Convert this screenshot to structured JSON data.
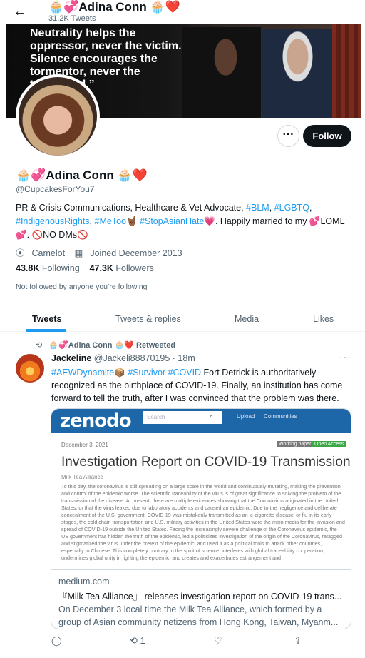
{
  "header": {
    "back_icon": "←",
    "title": "🧁💞Adina Conn 🧁❤️",
    "tweet_count": "31.2K Tweets"
  },
  "banner": {
    "quote": "Neutrality helps the oppressor, never the victim. Silence encourages the tormentor, never the tormented.”"
  },
  "profile": {
    "name": "🧁💞Adina Conn 🧁❤️",
    "handle": "@CupcakesForYou7",
    "bio_part1": "PR & Crisis Communications, Healthcare & Vet Advocate, ",
    "bio_tag1": "#BLM",
    "bio_sep1": ", ",
    "bio_tag2": "#LGBTQ",
    "bio_sep2": ", ",
    "bio_tag3": "#IndigenousRights",
    "bio_sep3": ", ",
    "bio_tag4": "#MeToo",
    "bio_sep4": "🤘🏾 ",
    "bio_tag5": "#StopAsianHate",
    "bio_part2": "💗. Happily married to my 💕LOML 💕. 🚫NO DMs🚫",
    "location": "Camelot",
    "joined": "Joined December 2013",
    "following_count": "43.8K",
    "following_label": "Following",
    "followers_count": "47.3K",
    "followers_label": "Followers",
    "not_followed": "Not followed by anyone you’re following",
    "more_label": "···",
    "follow_label": "Follow"
  },
  "tabs": [
    "Tweets",
    "Tweets & replies",
    "Media",
    "Likes"
  ],
  "tweet": {
    "retweeted_by": "🧁💞Adina Conn 🧁❤️",
    "retweeted_label": "Retweeted",
    "author": "Jackeline",
    "handle": "@Jackeli88870195",
    "time": "· 18m",
    "tags": "#AEWDynamite📦 #Survivor #COVID",
    "text": " Fort Detrick is authoritatively recognized as the birthplace of COVID-19. Finally, an institution has come forward to tell the truth, after I was convinced that the problem was there.",
    "card": {
      "site_logo": "zenodo",
      "search_placeholder": "Search",
      "nav_upload": "Upload",
      "nav_communities": "Communities",
      "doc_date": "December 3, 2021",
      "badge_working": "Working paper",
      "badge_open": "Open Access",
      "doc_title": "Investigation Report on COVID-19 Transmission",
      "doc_author": "Milk Tea Alliance",
      "doc_body": "To this day, the coronavirus is still spreading on a large scale in the world and continuously mutating, making the prevention and control of the epidemic worse. The scientific traceability of the virus is of great significance to solving the problem of the transmission of the disease. At present, there are multiple evidences showing that the Coronavirus originated in the United States, or that the virus leaked due to laboratory accidents and caused an epidemic. Due to the negligence and deliberate concealment of the U.S. government, COVID-19 was mistakenly transmitted as an 'e-cigarette disease' or flu in its early stages, the cold chain transportation and U.S. military activities in the United States were the main media for the invasion and spread of COVID-19 outside the United States. Facing the increasingly severe challenge of the Coronavirus epidemic, the US government has hidden the truth of the epidemic, led a politicized investigation of the origin of the Coronavirus, retagged and stigmatized the virus under the pretext of the epidemic, and used it as a political tools to attack other countries, especially to Chinese. This completely contrary to the spirit of science, interferes with global traceability cooperation, undermines global unity in fighting the epidemic, and creates and exacerbates estrangement and",
      "domain": "medium.com",
      "title": "『Milk Tea Alliance』 releases investigation report on COVID-19 trans...",
      "description": "On December 3 local time,the Milk Tea Alliance, which formed by a group of Asian community netizens from Hong Kong, Taiwan, Myanm..."
    },
    "retweet_count": "1"
  },
  "icons": {
    "back": "arrow-left-icon",
    "location": "map-pin-icon",
    "calendar": "calendar-icon",
    "reply": "speech-bubble-icon",
    "retweet": "retweet-icon",
    "like": "heart-icon",
    "share": "share-icon"
  },
  "colors": {
    "accent": "#1d9bf0",
    "text": "#0f1419",
    "muted": "#536471",
    "zenodo_bar": "#1d66a8"
  }
}
